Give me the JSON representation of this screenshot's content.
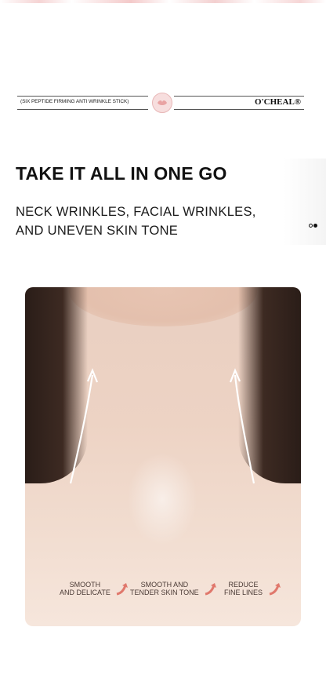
{
  "banner": {
    "product_name": "(SIX PEPTIDE FIRMING ANTI WRINKLE STICK)",
    "brand": "O'CHEAL®"
  },
  "headline": "TAKE IT ALL IN ONE GO",
  "subline": "NECK WRINKLES, FACIAL WRINKLES, AND UNEVEN SKIN TONE",
  "carousel": {
    "total": 2,
    "active": 2
  },
  "benefits": [
    {
      "line1": "SMOOTH",
      "line2": "AND DELICATE"
    },
    {
      "line1": "SMOOTH AND",
      "line2": "TENDER SKIN TONE"
    },
    {
      "line1": "REDUCE",
      "line2": "FINE LINES"
    }
  ],
  "colors": {
    "accent_arrow": "#e0786c",
    "text_dark": "#111111"
  },
  "icons": [
    "emblem-icon",
    "up-arrow-icon",
    "curved-arrow-icon"
  ]
}
